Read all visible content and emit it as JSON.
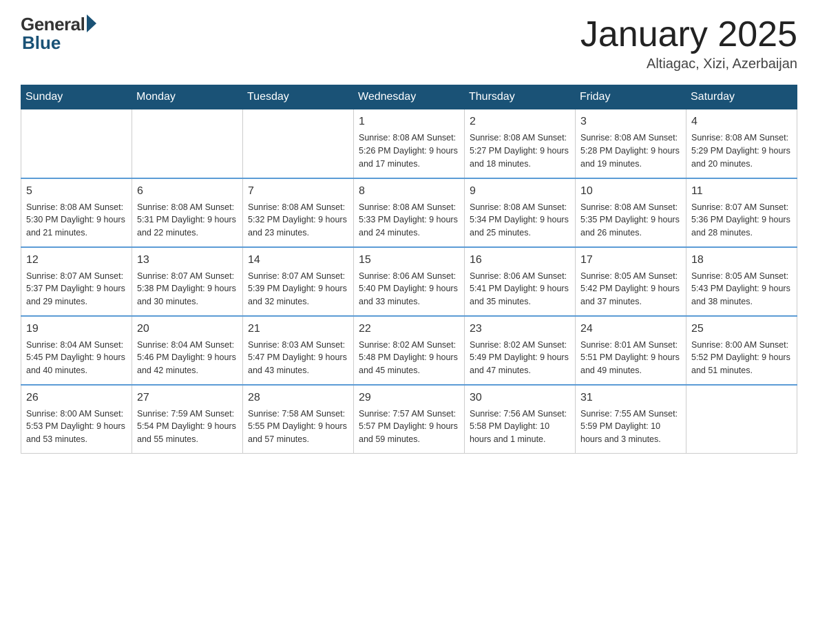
{
  "header": {
    "logo_general": "General",
    "logo_blue": "Blue",
    "month_title": "January 2025",
    "location": "Altiagac, Xizi, Azerbaijan"
  },
  "days_of_week": [
    "Sunday",
    "Monday",
    "Tuesday",
    "Wednesday",
    "Thursday",
    "Friday",
    "Saturday"
  ],
  "weeks": [
    [
      {
        "day": "",
        "info": ""
      },
      {
        "day": "",
        "info": ""
      },
      {
        "day": "",
        "info": ""
      },
      {
        "day": "1",
        "info": "Sunrise: 8:08 AM\nSunset: 5:26 PM\nDaylight: 9 hours\nand 17 minutes."
      },
      {
        "day": "2",
        "info": "Sunrise: 8:08 AM\nSunset: 5:27 PM\nDaylight: 9 hours\nand 18 minutes."
      },
      {
        "day": "3",
        "info": "Sunrise: 8:08 AM\nSunset: 5:28 PM\nDaylight: 9 hours\nand 19 minutes."
      },
      {
        "day": "4",
        "info": "Sunrise: 8:08 AM\nSunset: 5:29 PM\nDaylight: 9 hours\nand 20 minutes."
      }
    ],
    [
      {
        "day": "5",
        "info": "Sunrise: 8:08 AM\nSunset: 5:30 PM\nDaylight: 9 hours\nand 21 minutes."
      },
      {
        "day": "6",
        "info": "Sunrise: 8:08 AM\nSunset: 5:31 PM\nDaylight: 9 hours\nand 22 minutes."
      },
      {
        "day": "7",
        "info": "Sunrise: 8:08 AM\nSunset: 5:32 PM\nDaylight: 9 hours\nand 23 minutes."
      },
      {
        "day": "8",
        "info": "Sunrise: 8:08 AM\nSunset: 5:33 PM\nDaylight: 9 hours\nand 24 minutes."
      },
      {
        "day": "9",
        "info": "Sunrise: 8:08 AM\nSunset: 5:34 PM\nDaylight: 9 hours\nand 25 minutes."
      },
      {
        "day": "10",
        "info": "Sunrise: 8:08 AM\nSunset: 5:35 PM\nDaylight: 9 hours\nand 26 minutes."
      },
      {
        "day": "11",
        "info": "Sunrise: 8:07 AM\nSunset: 5:36 PM\nDaylight: 9 hours\nand 28 minutes."
      }
    ],
    [
      {
        "day": "12",
        "info": "Sunrise: 8:07 AM\nSunset: 5:37 PM\nDaylight: 9 hours\nand 29 minutes."
      },
      {
        "day": "13",
        "info": "Sunrise: 8:07 AM\nSunset: 5:38 PM\nDaylight: 9 hours\nand 30 minutes."
      },
      {
        "day": "14",
        "info": "Sunrise: 8:07 AM\nSunset: 5:39 PM\nDaylight: 9 hours\nand 32 minutes."
      },
      {
        "day": "15",
        "info": "Sunrise: 8:06 AM\nSunset: 5:40 PM\nDaylight: 9 hours\nand 33 minutes."
      },
      {
        "day": "16",
        "info": "Sunrise: 8:06 AM\nSunset: 5:41 PM\nDaylight: 9 hours\nand 35 minutes."
      },
      {
        "day": "17",
        "info": "Sunrise: 8:05 AM\nSunset: 5:42 PM\nDaylight: 9 hours\nand 37 minutes."
      },
      {
        "day": "18",
        "info": "Sunrise: 8:05 AM\nSunset: 5:43 PM\nDaylight: 9 hours\nand 38 minutes."
      }
    ],
    [
      {
        "day": "19",
        "info": "Sunrise: 8:04 AM\nSunset: 5:45 PM\nDaylight: 9 hours\nand 40 minutes."
      },
      {
        "day": "20",
        "info": "Sunrise: 8:04 AM\nSunset: 5:46 PM\nDaylight: 9 hours\nand 42 minutes."
      },
      {
        "day": "21",
        "info": "Sunrise: 8:03 AM\nSunset: 5:47 PM\nDaylight: 9 hours\nand 43 minutes."
      },
      {
        "day": "22",
        "info": "Sunrise: 8:02 AM\nSunset: 5:48 PM\nDaylight: 9 hours\nand 45 minutes."
      },
      {
        "day": "23",
        "info": "Sunrise: 8:02 AM\nSunset: 5:49 PM\nDaylight: 9 hours\nand 47 minutes."
      },
      {
        "day": "24",
        "info": "Sunrise: 8:01 AM\nSunset: 5:51 PM\nDaylight: 9 hours\nand 49 minutes."
      },
      {
        "day": "25",
        "info": "Sunrise: 8:00 AM\nSunset: 5:52 PM\nDaylight: 9 hours\nand 51 minutes."
      }
    ],
    [
      {
        "day": "26",
        "info": "Sunrise: 8:00 AM\nSunset: 5:53 PM\nDaylight: 9 hours\nand 53 minutes."
      },
      {
        "day": "27",
        "info": "Sunrise: 7:59 AM\nSunset: 5:54 PM\nDaylight: 9 hours\nand 55 minutes."
      },
      {
        "day": "28",
        "info": "Sunrise: 7:58 AM\nSunset: 5:55 PM\nDaylight: 9 hours\nand 57 minutes."
      },
      {
        "day": "29",
        "info": "Sunrise: 7:57 AM\nSunset: 5:57 PM\nDaylight: 9 hours\nand 59 minutes."
      },
      {
        "day": "30",
        "info": "Sunrise: 7:56 AM\nSunset: 5:58 PM\nDaylight: 10 hours\nand 1 minute."
      },
      {
        "day": "31",
        "info": "Sunrise: 7:55 AM\nSunset: 5:59 PM\nDaylight: 10 hours\nand 3 minutes."
      },
      {
        "day": "",
        "info": ""
      }
    ]
  ]
}
